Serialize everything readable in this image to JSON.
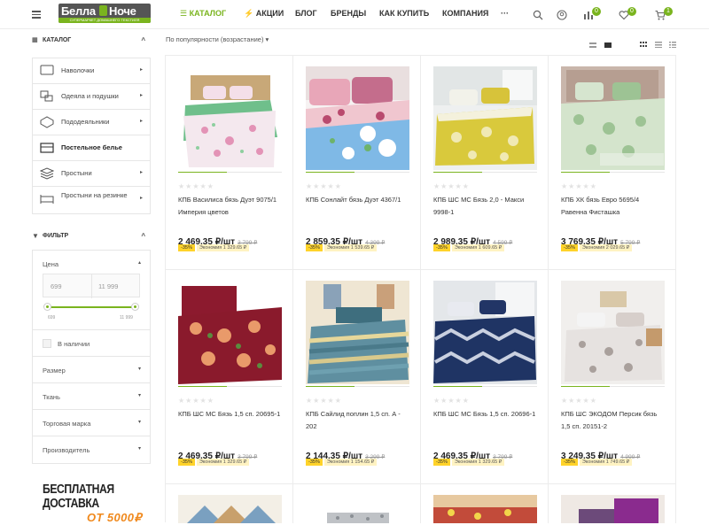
{
  "header": {
    "logo_left": "Белла",
    "logo_right": "Ноче",
    "logo_sub": "СУПЕРМАРКЕТ ДОМАШНЕГО ТЕКСТИЛЯ",
    "nav": [
      "КАТАЛОГ",
      "АКЦИИ",
      "БЛОГ",
      "БРЕНДЫ",
      "КАК КУПИТЬ",
      "КОМПАНИЯ",
      "···"
    ],
    "compare_count": "0",
    "favorites_count": "0",
    "cart_count": "1",
    "accent": "#7ab41e"
  },
  "sidebar": {
    "catalog_title": "КАТАЛОГ",
    "categories": [
      {
        "label": "Наволочки",
        "icon": "pillowcase-icon"
      },
      {
        "label": "Одеяла и подушки",
        "icon": "blanket-icon"
      },
      {
        "label": "Пододеяльники",
        "icon": "duvet-cover-icon"
      },
      {
        "label": "Постельное белье",
        "icon": "bed-linen-icon",
        "active": true
      },
      {
        "label": "Простыни",
        "icon": "sheets-icon"
      },
      {
        "label": "Простыни на резинке",
        "icon": "fitted-sheet-icon"
      }
    ],
    "filter_title": "ФИЛЬТР",
    "price_label": "Цена",
    "price_min": "699",
    "price_max": "11 999",
    "range_min": "699",
    "range_max": "11 999",
    "in_stock": "В наличии",
    "filters": [
      "Размер",
      "Ткань",
      "Торговая марка",
      "Производитель"
    ]
  },
  "promo": {
    "line1": "БЕСПЛАТНАЯ ДОСТАВКА",
    "line2": "ОТ 5000₽"
  },
  "toolbar": {
    "sort": "По популярности (возрастание)"
  },
  "products": [
    {
      "name": "КПБ Василиса бязь Дуэт 9075/1 Империя цветов",
      "price": "2 469.35 ₽/шт",
      "old": "3 799 ₽",
      "pct": "-35%",
      "eco": "Экономия 1 329.65 ₽"
    },
    {
      "name": "КПБ Сонлайт бязь Дуэт 4367/1",
      "price": "2 859.35 ₽/шт",
      "old": "4 399 ₽",
      "pct": "-35%",
      "eco": "Экономия 1 539.65 ₽"
    },
    {
      "name": "КПБ ШС МС Бязь 2,0 - Макси 9998-1",
      "price": "2 989.35 ₽/шт",
      "old": "4 599 ₽",
      "pct": "-35%",
      "eco": "Экономия 1 609.65 ₽"
    },
    {
      "name": "КПБ ХК бязь Евро 5695/4 Равенна Фисташка",
      "price": "3 769.35 ₽/шт",
      "old": "5 799 ₽",
      "pct": "-35%",
      "eco": "Экономия 2 029.65 ₽"
    },
    {
      "name": "КПБ ШС МС Бязь 1,5 сп. 20695-1",
      "price": "2 469.35 ₽/шт",
      "old": "3 799 ₽",
      "pct": "-35%",
      "eco": "Экономия 1 329.65 ₽"
    },
    {
      "name": "КПБ Сайлид поплин 1,5 сп. А - 202",
      "price": "2 144.35 ₽/шт",
      "old": "3 299 ₽",
      "pct": "-35%",
      "eco": "Экономия 1 154.65 ₽"
    },
    {
      "name": "КПБ ШС МС Бязь 1,5 сп. 20696-1",
      "price": "2 469.35 ₽/шт",
      "old": "3 799 ₽",
      "pct": "-35%",
      "eco": "Экономия 1 329.65 ₽"
    },
    {
      "name": "КПБ ШС ЭКОДОМ Персик бязь 1,5 сп. 20151-2",
      "price": "3 249.35 ₽/шт",
      "old": "4 999 ₽",
      "pct": "-35%",
      "eco": "Экономия 1 749.65 ₽"
    }
  ]
}
